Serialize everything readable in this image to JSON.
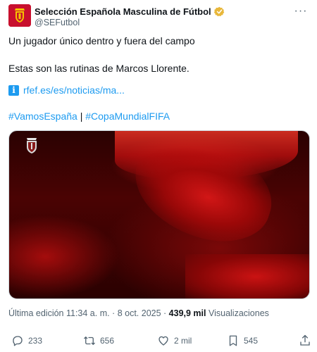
{
  "account": {
    "name": "Selección Española Masculina de Fútbol",
    "handle": "@SEFutbol",
    "verified_color": "#e8b73a"
  },
  "tweet": {
    "line1": "Un jugador único dentro y fuera del campo",
    "line2": "Estas son las rutinas de Marcos Llorente.",
    "link_icon": "info-icon",
    "link_text": "rfef.es/es/noticias/ma...",
    "hashtag1": "#VamosEspaña",
    "separator": "|",
    "hashtag2": "#CopaMundialFIFA"
  },
  "meta": {
    "edited": "Última edición 11:34 a. m. · 8 oct. 2025 ·",
    "views_count": "439,9 mil",
    "views_label": "Visualizaciones"
  },
  "actions": {
    "replies": "233",
    "reposts": "656",
    "likes": "2 mil",
    "bookmarks": "545"
  },
  "colors": {
    "link": "#1d9bf0",
    "text": "#0f1419",
    "muted": "#536471",
    "brand_red": "#c8102e"
  }
}
